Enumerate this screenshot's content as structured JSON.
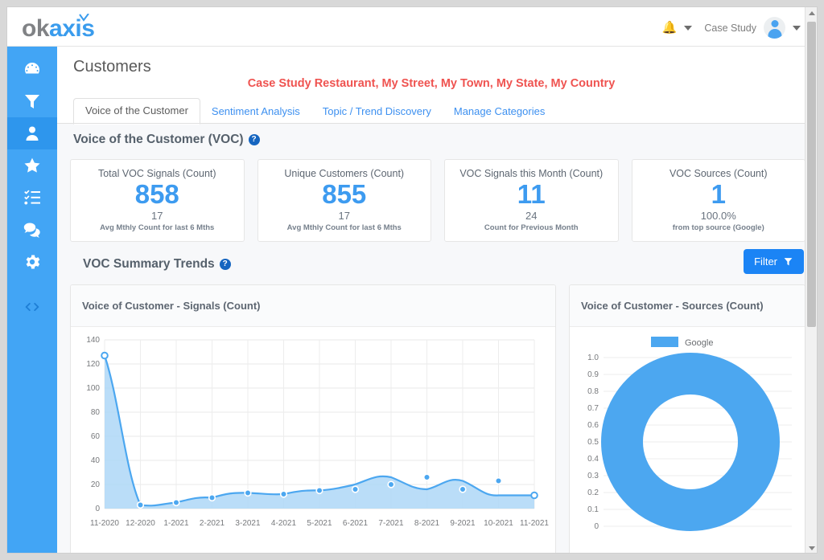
{
  "brand": {
    "name_gray": "ok",
    "name_blue": "axis"
  },
  "topbar": {
    "notifications_icon": "bell-icon",
    "username": "Case Study",
    "avatar_icon": "user-avatar-icon"
  },
  "sidebar": {
    "items": [
      {
        "name": "dashboard",
        "icon": "gauge-icon",
        "active": false
      },
      {
        "name": "filters",
        "icon": "funnel-icon",
        "active": false
      },
      {
        "name": "customers",
        "icon": "person-icon",
        "active": true
      },
      {
        "name": "favourites",
        "icon": "star-icon",
        "active": false
      },
      {
        "name": "tasks",
        "icon": "checklist-icon",
        "active": false
      },
      {
        "name": "messages",
        "icon": "chat-bubbles-icon",
        "active": false
      },
      {
        "name": "settings",
        "icon": "gear-icon",
        "active": false
      },
      {
        "name": "developer",
        "icon": "code-brackets-icon",
        "active": false
      }
    ]
  },
  "page": {
    "title": "Customers",
    "site_line": "Case Study Restaurant, My Street, My Town, My State, My Country",
    "tabs": [
      {
        "label": "Voice of the Customer",
        "active": true
      },
      {
        "label": "Sentiment Analysis",
        "active": false
      },
      {
        "label": "Topic / Trend Discovery",
        "active": false
      },
      {
        "label": "Manage Categories",
        "active": false
      }
    ]
  },
  "voc_section": {
    "heading": "Voice of the Customer (VOC)",
    "help_glyph": "?",
    "cards": [
      {
        "label": "Total VOC Signals (Count)",
        "value": "858",
        "sub_value": "17",
        "sub_label": "Avg Mthly Count for last 6 Mths"
      },
      {
        "label": "Unique Customers (Count)",
        "value": "855",
        "sub_value": "17",
        "sub_label": "Avg Mthly Count for last 6 Mths"
      },
      {
        "label": "VOC Signals this Month (Count)",
        "value": "11",
        "sub_value": "24",
        "sub_label": "Count for Previous Month"
      },
      {
        "label": "VOC Sources (Count)",
        "value": "1",
        "sub_value": "100.0%",
        "sub_label": "from top source (Google)"
      }
    ]
  },
  "trends_section": {
    "heading": "VOC Summary Trends",
    "help_glyph": "?",
    "filter_label": "Filter",
    "filter_icon": "funnel-icon"
  },
  "chart_data": [
    {
      "type": "area",
      "title": "Voice of Customer - Signals (Count)",
      "xlabel": "",
      "ylabel": "",
      "categories": [
        "11-2020",
        "12-2020",
        "1-2021",
        "2-2021",
        "3-2021",
        "4-2021",
        "5-2021",
        "6-2021",
        "7-2021",
        "8-2021",
        "9-2021",
        "10-2021",
        "11-2021"
      ],
      "values": [
        127,
        3,
        5,
        9,
        13,
        12,
        15,
        16,
        20,
        26,
        16,
        23,
        11
      ],
      "yticks": [
        0,
        20,
        40,
        60,
        80,
        100,
        120,
        140
      ],
      "ylim": [
        0,
        140
      ],
      "grid": true,
      "legend": "none",
      "series_color": "#4ca7f0",
      "fill_color": "#aed7f7"
    },
    {
      "type": "pie",
      "title": "Voice of Customer - Sources (Count)",
      "labels": [
        "Google"
      ],
      "values": [
        1
      ],
      "percentages": [
        100.0
      ],
      "yticks": [
        "0",
        "0.1",
        "0.2",
        "0.3",
        "0.4",
        "0.5",
        "0.6",
        "0.7",
        "0.8",
        "0.9",
        "1.0"
      ],
      "ylim": [
        0,
        1
      ],
      "grid": true,
      "legend": "top",
      "donut": true,
      "series_color": "#4ca7f0"
    }
  ],
  "scrollbar": {
    "up_icon": "chevron-up-icon",
    "down_icon": "chevron-down-icon"
  }
}
